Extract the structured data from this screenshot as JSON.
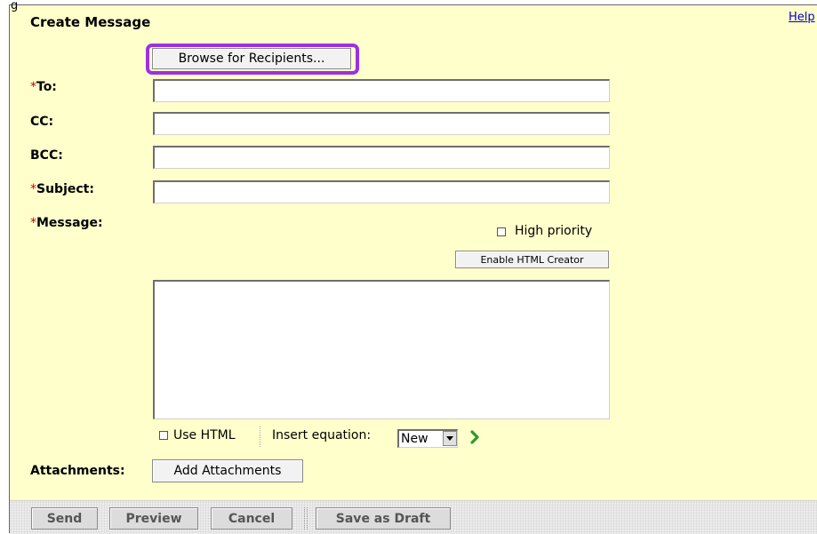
{
  "page": {
    "cut_letter": "g",
    "title": "Create Message",
    "help_link": "Help"
  },
  "recipients": {
    "browse_button": "Browse for Recipients..."
  },
  "fields": {
    "to_label": "To:",
    "cc_label": "CC:",
    "bcc_label": "BCC:",
    "subject_label": "Subject:",
    "message_label": "Message:",
    "required_marker": "*",
    "to_value": "",
    "cc_value": "",
    "bcc_value": "",
    "subject_value": "",
    "message_value": ""
  },
  "message_options": {
    "high_priority_label": "High priority",
    "enable_html_creator": "Enable HTML Creator",
    "use_html_label": "Use HTML",
    "insert_equation_label": "Insert equation:",
    "equation_select_value": "New"
  },
  "attachments": {
    "label": "Attachments:",
    "add_button": "Add Attachments"
  },
  "actions": {
    "send": "Send",
    "preview": "Preview",
    "cancel": "Cancel",
    "save_draft": "Save as Draft"
  },
  "colors": {
    "panel_background": "#ffffcc",
    "highlight_border": "#9b30e8",
    "required_marker": "#cc0000",
    "link": "#0000cc"
  },
  "icons": {
    "go": "green-chevron-right-icon",
    "dropdown": "chevron-down-icon"
  }
}
